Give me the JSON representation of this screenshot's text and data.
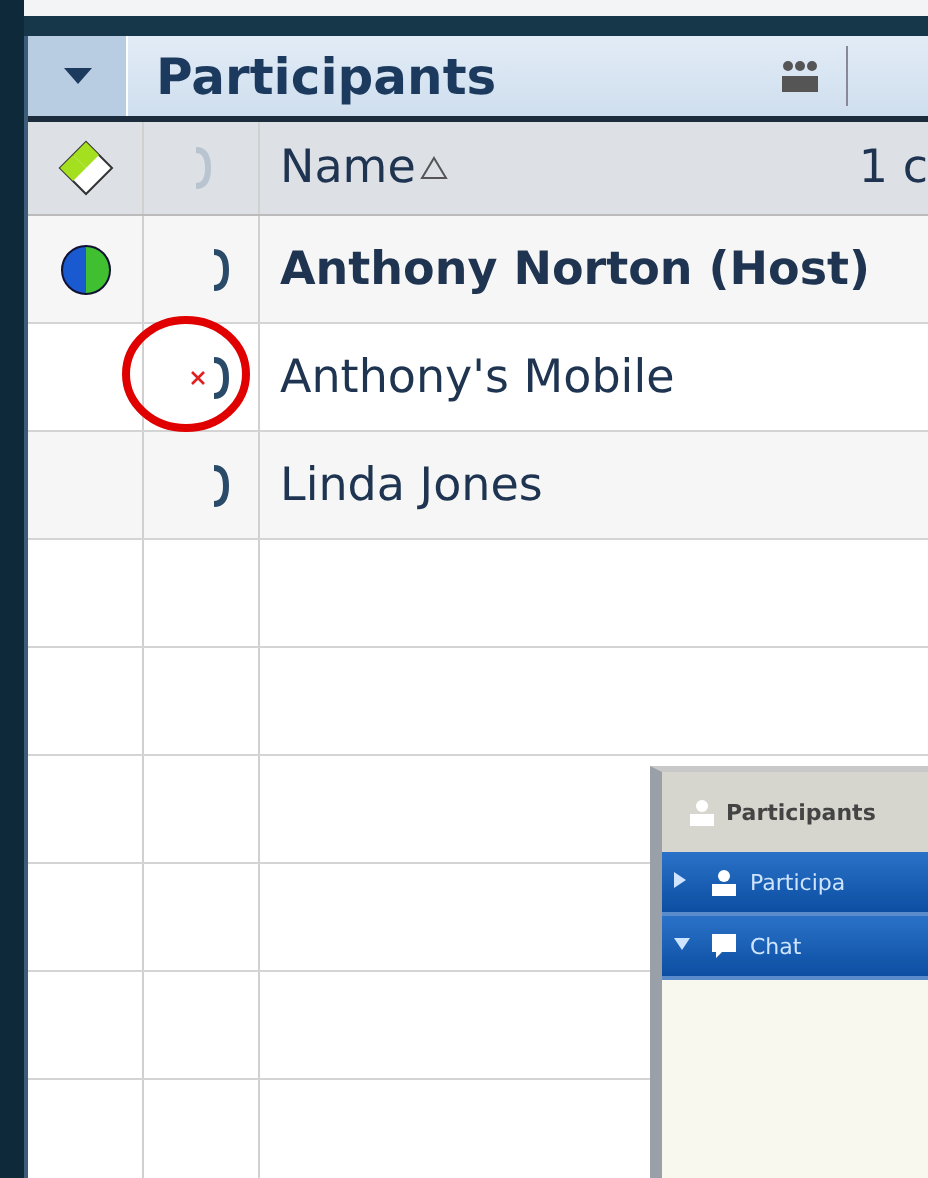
{
  "panel": {
    "title": "Participants",
    "header": {
      "name": "Name",
      "sorted": true,
      "column_3": "1 c"
    },
    "rows": [
      {
        "name": "Anthony Norton (Host)",
        "host": true,
        "web": true,
        "phone_disconnected": false,
        "circled": false
      },
      {
        "name": "Anthony's Mobile",
        "host": false,
        "web": false,
        "phone_disconnected": true,
        "circled": true
      },
      {
        "name": "Linda Jones",
        "host": false,
        "web": false,
        "phone_disconnected": false,
        "circled": false
      }
    ]
  },
  "mini_window": {
    "title": "Participants",
    "sections": [
      {
        "label": "Participa",
        "kind": "participants",
        "expanded": false
      },
      {
        "label": "Chat",
        "kind": "chat",
        "expanded": true
      }
    ]
  }
}
